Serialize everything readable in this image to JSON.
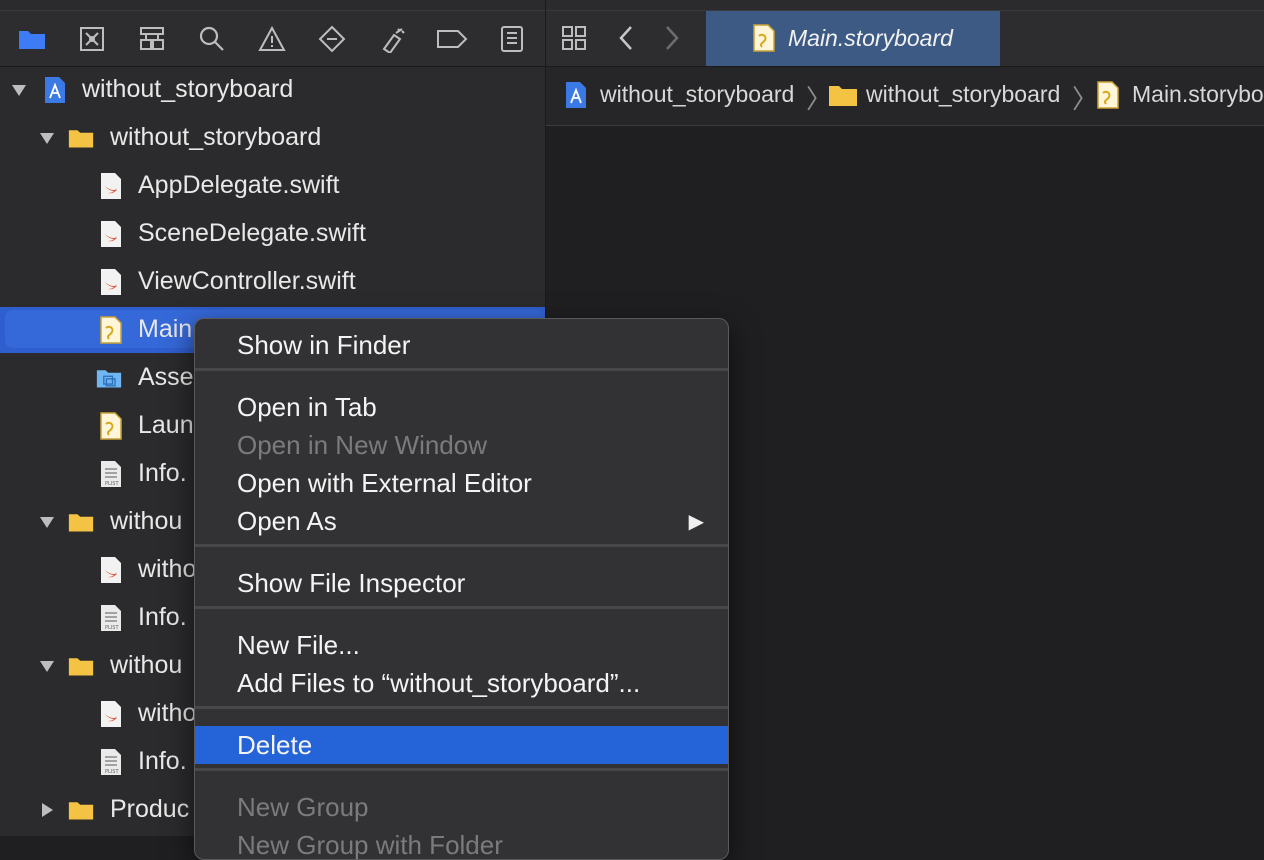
{
  "navigator": {
    "toolbar_icons": [
      "folder-icon",
      "source-control-icon",
      "hierarchy-icon",
      "search-icon",
      "warning-icon",
      "test-diamond-icon",
      "debug-icon",
      "breakpoint-icon",
      "report-icon"
    ],
    "tree": [
      {
        "label": "without_storyboard",
        "kind": "project",
        "level": 0,
        "disclosure": "open"
      },
      {
        "label": "without_storyboard",
        "kind": "folder",
        "level": 1,
        "disclosure": "open"
      },
      {
        "label": "AppDelegate.swift",
        "kind": "swift",
        "level": 2
      },
      {
        "label": "SceneDelegate.swift",
        "kind": "swift",
        "level": 2
      },
      {
        "label": "ViewController.swift",
        "kind": "swift",
        "level": 2
      },
      {
        "label": "Main",
        "kind": "storyboard",
        "level": 2,
        "selected": true
      },
      {
        "label": "Asse",
        "kind": "assets",
        "level": 2
      },
      {
        "label": "Laun",
        "kind": "storyboard",
        "level": 2
      },
      {
        "label": "Info.",
        "kind": "plist",
        "level": 2
      },
      {
        "label": "withou",
        "kind": "folder",
        "level": 1,
        "disclosure": "open"
      },
      {
        "label": "witho",
        "kind": "swift",
        "level": 2
      },
      {
        "label": "Info.",
        "kind": "plist",
        "level": 2
      },
      {
        "label": "withou",
        "kind": "folder",
        "level": 1,
        "disclosure": "open"
      },
      {
        "label": "witho",
        "kind": "swift",
        "level": 2
      },
      {
        "label": "Info.",
        "kind": "plist",
        "level": 2
      },
      {
        "label": "Produc",
        "kind": "folder",
        "level": 1,
        "disclosure": "closed"
      }
    ]
  },
  "editor": {
    "active_tab": "Main.storyboard",
    "breadcrumb": [
      "without_storyboard",
      "without_storyboard",
      "Main.storyboa"
    ]
  },
  "context_menu": {
    "items": [
      {
        "label": "Show in Finder",
        "enabled": true
      },
      {
        "separator": true
      },
      {
        "label": "Open in Tab",
        "enabled": true
      },
      {
        "label": "Open in New Window",
        "enabled": false
      },
      {
        "label": "Open with External Editor",
        "enabled": true
      },
      {
        "label": "Open As",
        "enabled": true,
        "submenu": true
      },
      {
        "separator": true
      },
      {
        "label": "Show File Inspector",
        "enabled": true
      },
      {
        "separator": true
      },
      {
        "label": "New File...",
        "enabled": true
      },
      {
        "label": "Add Files to “without_storyboard”...",
        "enabled": true
      },
      {
        "separator": true
      },
      {
        "label": "Delete",
        "enabled": true,
        "highlighted": true
      },
      {
        "separator": true
      },
      {
        "label": "New Group",
        "enabled": false
      },
      {
        "label": "New Group with Folder",
        "enabled": false
      }
    ]
  },
  "colors": {
    "selection": "#2f5fcf",
    "menu_highlight": "#2563d8",
    "tab_active": "#3d5a84",
    "folder": "#f5c343",
    "swift": "#e8543a"
  }
}
